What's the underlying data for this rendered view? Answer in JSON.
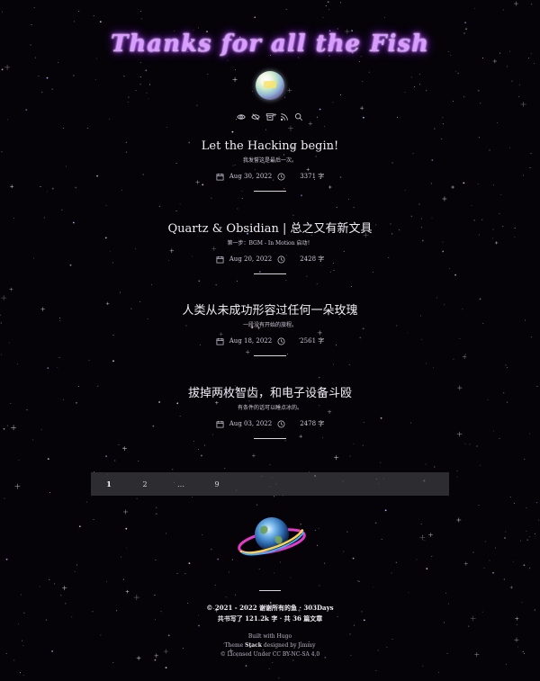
{
  "site": {
    "title": "Thanks for all the Fish"
  },
  "nav_icons": [
    "eye-icon",
    "eye-off-icon",
    "archive-icon",
    "rss-icon",
    "search-icon"
  ],
  "posts": [
    {
      "title": "Let the Hacking begin!",
      "subtitle": "我发誓这是最后一次。",
      "date": "Aug 30, 2022",
      "words": "3371 字"
    },
    {
      "title": "Quartz & Obsidian | 总之又有新文具",
      "subtitle": "第一步：BGM - In Motion 启动！",
      "date": "Aug 20, 2022",
      "words": "2428 字"
    },
    {
      "title": "人类从未成功形容过任何一朵玫瑰",
      "subtitle": "一段没有开始的旅程。",
      "date": "Aug 18, 2022",
      "words": "2561 字"
    },
    {
      "title": "拔掉两枚智齿，和电子设备斗殴",
      "subtitle": "有条件的话可以睡点冰的。",
      "date": "Aug 03, 2022",
      "words": "2478 字"
    }
  ],
  "pagination": {
    "pages": [
      "1",
      "2",
      "…",
      "9"
    ],
    "current": "1"
  },
  "footer": {
    "copyright": "© 2021 - 2022 谢谢所有的鱼 · 303Days",
    "stats": "共书写了 121.2k 字 · 共 36 篇文章",
    "built_with": "Built with Hugo",
    "theme_prefix": "Theme ",
    "theme_name": "Stack",
    "theme_suffix": " designed by Jimmy",
    "license": "© Licensed Under CC BY-NC-SA 4.0"
  },
  "colors": {
    "background": "#050308",
    "title_glow": "#b24bff",
    "pagination_bg": "#46464a"
  }
}
